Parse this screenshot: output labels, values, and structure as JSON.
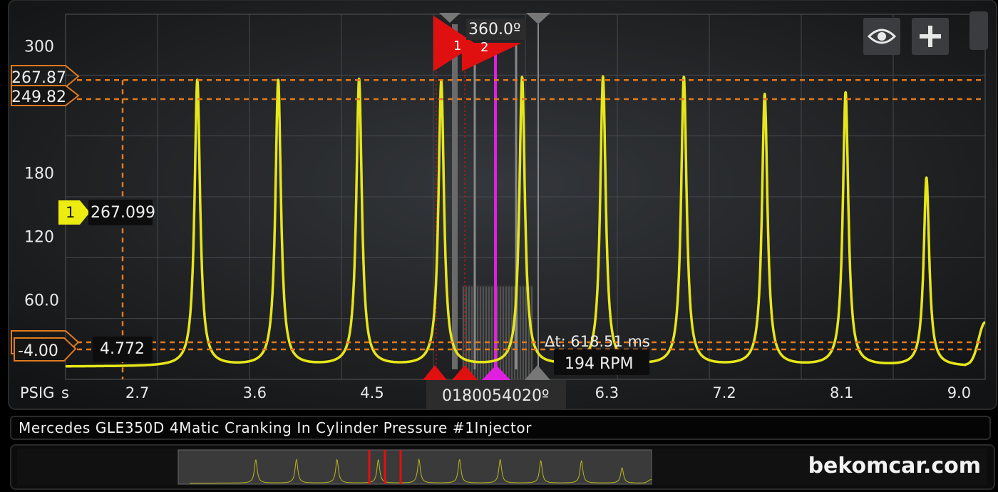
{
  "chart_data": {
    "type": "line",
    "title": "Mercedes GLE350D 4Matic Cranking In Cylinder Pressure #1Injector",
    "ylabel": "PSIG",
    "xlabel": "s",
    "xlim": [
      2.15,
      9.2
    ],
    "ylim": [
      -15,
      330
    ],
    "yticks": [
      {
        "value": 300,
        "label": "300"
      },
      {
        "value": 180,
        "label": "180"
      },
      {
        "value": 120,
        "label": "120"
      },
      {
        "value": 60,
        "label": "60.0"
      }
    ],
    "xticks": [
      {
        "value": 2.7,
        "label": "2.7"
      },
      {
        "value": 3.6,
        "label": "3.6"
      },
      {
        "value": 4.5,
        "label": "4.5"
      },
      {
        "value": 6.3,
        "label": "6.3"
      },
      {
        "value": 7.2,
        "label": "7.2"
      },
      {
        "value": 8.1,
        "label": "8.1"
      },
      {
        "value": 9.0,
        "label": "9.0"
      }
    ],
    "series": [
      {
        "name": "1",
        "color": "#e6e619",
        "baseline": -3,
        "peaks": [
          {
            "x": 3.16,
            "y": 267.5
          },
          {
            "x": 3.78,
            "y": 267.0
          },
          {
            "x": 4.4,
            "y": 267.8
          },
          {
            "x": 5.03,
            "y": 266.2
          },
          {
            "x": 5.65,
            "y": 269.5
          },
          {
            "x": 6.27,
            "y": 270.0
          },
          {
            "x": 6.89,
            "y": 269.8
          },
          {
            "x": 7.51,
            "y": 253.5
          },
          {
            "x": 8.13,
            "y": 255.5
          },
          {
            "x": 8.75,
            "y": 175.0
          }
        ],
        "tail": {
          "x": 9.2,
          "y": 38
        }
      }
    ],
    "grid": true
  },
  "ui": {
    "channel_badge": "1",
    "cursor_value_top": "267.099",
    "cursor_value_bottom": "4.772",
    "ref_line_upper_label": "267.87",
    "ref_line_mid_label": "249.82",
    "ref_line_lower_label": "-4.00",
    "ref_values": {
      "upper": 267.87,
      "mid": 249.82,
      "lower": -4.0
    },
    "delta_time": "Δt: 618.51 ms",
    "rpm": "194 RPM",
    "angle_readout": "360.0º",
    "marker_1": "1",
    "marker_2": "2",
    "cursor_bottom_overlap": "0180054020º",
    "axis_unit_y": "PSIG",
    "axis_unit_x": "s",
    "eye_icon": "eye-icon",
    "plus_icon": "plus-icon",
    "watermark": "bekomcar.com",
    "accent_orange": "#e07a1f",
    "accent_magenta": "#e020e0",
    "accent_red": "#e01010"
  }
}
